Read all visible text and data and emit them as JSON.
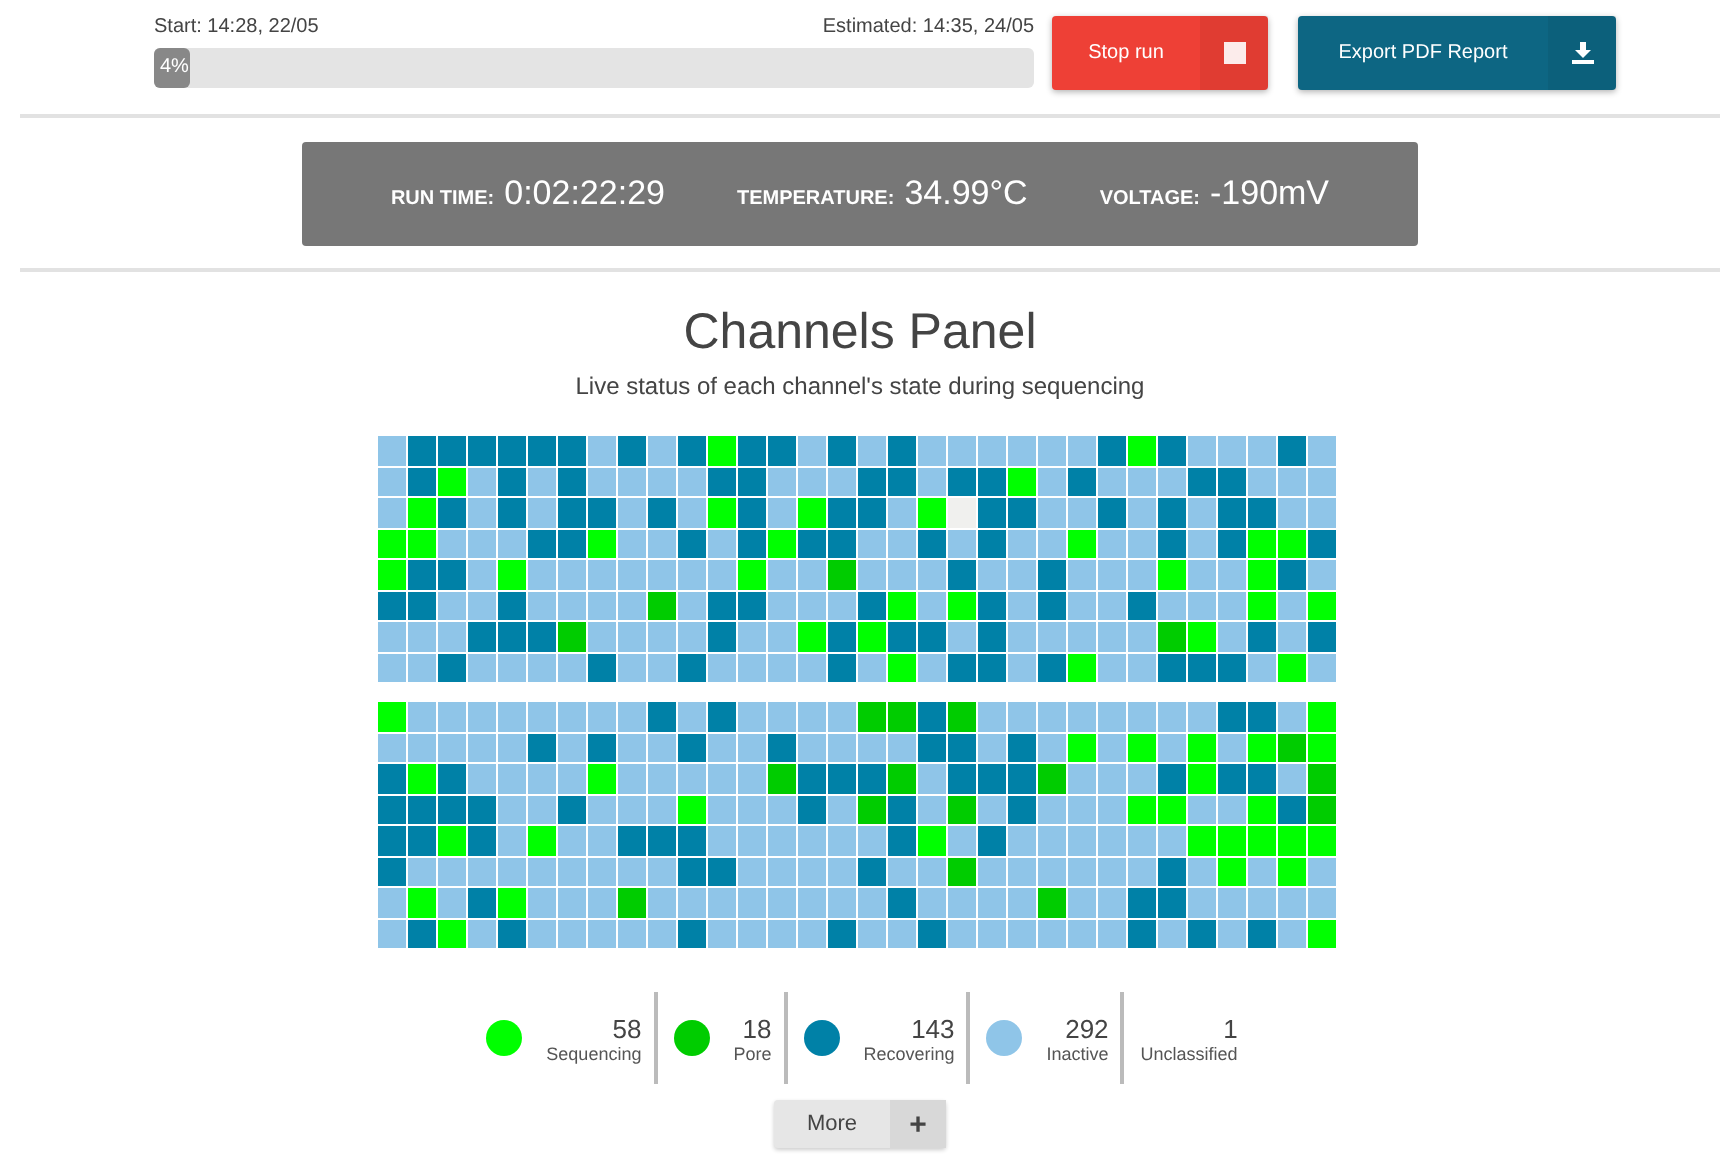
{
  "run_progress": {
    "start": "Start: 14:28, 22/05",
    "estimated": "Estimated: 14:35, 24/05",
    "level": 0.04,
    "label": "4%"
  },
  "buttons": [
    {
      "kind": "stop",
      "label": "Stop run"
    },
    {
      "kind": "export",
      "label": "Export PDF Report"
    }
  ],
  "stats": [
    {
      "label": "RUN TIME:",
      "value": "0:02:22:29"
    },
    {
      "label": "TEMPERATURE:",
      "value": "34.99°C"
    },
    {
      "label": "VOLTAGE:",
      "value": "-190mV"
    }
  ],
  "panel": {
    "title": "Channels Panel",
    "subtitle": "Live status of each channel's state during sequencing"
  },
  "channel_grid": {
    "blocks": [
      {
        "rows": [
          {
            "cells": [
              {
                "color": "#8fc5e8"
              },
              {
                "color": "#0081a7"
              },
              {
                "color": "#0081a7"
              },
              {
                "color": "#0081a7"
              },
              {
                "color": "#0081a7"
              },
              {
                "color": "#0081a7"
              },
              {
                "color": "#0081a7"
              },
              {
                "color": "#8fc5e8"
              },
              {
                "color": "#0081a7"
              },
              {
                "color": "#8fc5e8"
              },
              {
                "color": "#0081a7"
              },
              {
                "color": "#00ff00"
              },
              {
                "color": "#0081a7"
              },
              {
                "color": "#0081a7"
              },
              {
                "color": "#8fc5e8"
              },
              {
                "color": "#0081a7"
              },
              {
                "color": "#8fc5e8"
              },
              {
                "color": "#0081a7"
              },
              {
                "color": "#8fc5e8"
              },
              {
                "color": "#8fc5e8"
              },
              {
                "color": "#8fc5e8"
              },
              {
                "color": "#8fc5e8"
              },
              {
                "color": "#8fc5e8"
              },
              {
                "color": "#8fc5e8"
              },
              {
                "color": "#0081a7"
              },
              {
                "color": "#00ff00"
              },
              {
                "color": "#0081a7"
              },
              {
                "color": "#8fc5e8"
              },
              {
                "color": "#8fc5e8"
              },
              {
                "color": "#8fc5e8"
              },
              {
                "color": "#0081a7"
              },
              {
                "color": "#8fc5e8"
              }
            ]
          },
          {
            "cells": [
              {
                "color": "#8fc5e8"
              },
              {
                "color": "#0081a7"
              },
              {
                "color": "#00ff00"
              },
              {
                "color": "#8fc5e8"
              },
              {
                "color": "#0081a7"
              },
              {
                "color": "#8fc5e8"
              },
              {
                "color": "#0081a7"
              },
              {
                "color": "#8fc5e8"
              },
              {
                "color": "#8fc5e8"
              },
              {
                "color": "#8fc5e8"
              },
              {
                "color": "#8fc5e8"
              },
              {
                "color": "#0081a7"
              },
              {
                "color": "#0081a7"
              },
              {
                "color": "#8fc5e8"
              },
              {
                "color": "#8fc5e8"
              },
              {
                "color": "#8fc5e8"
              },
              {
                "color": "#0081a7"
              },
              {
                "color": "#0081a7"
              },
              {
                "color": "#8fc5e8"
              },
              {
                "color": "#0081a7"
              },
              {
                "color": "#0081a7"
              },
              {
                "color": "#00ff00"
              },
              {
                "color": "#8fc5e8"
              },
              {
                "color": "#0081a7"
              },
              {
                "color": "#8fc5e8"
              },
              {
                "color": "#8fc5e8"
              },
              {
                "color": "#8fc5e8"
              },
              {
                "color": "#0081a7"
              },
              {
                "color": "#0081a7"
              },
              {
                "color": "#8fc5e8"
              },
              {
                "color": "#8fc5e8"
              },
              {
                "color": "#8fc5e8"
              }
            ]
          },
          {
            "cells": [
              {
                "color": "#8fc5e8"
              },
              {
                "color": "#00ff00"
              },
              {
                "color": "#0081a7"
              },
              {
                "color": "#8fc5e8"
              },
              {
                "color": "#0081a7"
              },
              {
                "color": "#8fc5e8"
              },
              {
                "color": "#0081a7"
              },
              {
                "color": "#0081a7"
              },
              {
                "color": "#8fc5e8"
              },
              {
                "color": "#0081a7"
              },
              {
                "color": "#8fc5e8"
              },
              {
                "color": "#00ff00"
              },
              {
                "color": "#0081a7"
              },
              {
                "color": "#8fc5e8"
              },
              {
                "color": "#00ff00"
              },
              {
                "color": "#0081a7"
              },
              {
                "color": "#0081a7"
              },
              {
                "color": "#8fc5e8"
              },
              {
                "color": "#00ff00"
              },
              {
                "color": "#f0f0ee"
              },
              {
                "color": "#0081a7"
              },
              {
                "color": "#0081a7"
              },
              {
                "color": "#8fc5e8"
              },
              {
                "color": "#8fc5e8"
              },
              {
                "color": "#0081a7"
              },
              {
                "color": "#8fc5e8"
              },
              {
                "color": "#0081a7"
              },
              {
                "color": "#8fc5e8"
              },
              {
                "color": "#0081a7"
              },
              {
                "color": "#0081a7"
              },
              {
                "color": "#8fc5e8"
              },
              {
                "color": "#8fc5e8"
              }
            ]
          },
          {
            "cells": [
              {
                "color": "#00ff00"
              },
              {
                "color": "#00ff00"
              },
              {
                "color": "#8fc5e8"
              },
              {
                "color": "#8fc5e8"
              },
              {
                "color": "#8fc5e8"
              },
              {
                "color": "#0081a7"
              },
              {
                "color": "#0081a7"
              },
              {
                "color": "#00ff00"
              },
              {
                "color": "#8fc5e8"
              },
              {
                "color": "#8fc5e8"
              },
              {
                "color": "#0081a7"
              },
              {
                "color": "#8fc5e8"
              },
              {
                "color": "#0081a7"
              },
              {
                "color": "#00ff00"
              },
              {
                "color": "#0081a7"
              },
              {
                "color": "#0081a7"
              },
              {
                "color": "#8fc5e8"
              },
              {
                "color": "#8fc5e8"
              },
              {
                "color": "#0081a7"
              },
              {
                "color": "#8fc5e8"
              },
              {
                "color": "#0081a7"
              },
              {
                "color": "#8fc5e8"
              },
              {
                "color": "#8fc5e8"
              },
              {
                "color": "#00ff00"
              },
              {
                "color": "#8fc5e8"
              },
              {
                "color": "#8fc5e8"
              },
              {
                "color": "#0081a7"
              },
              {
                "color": "#8fc5e8"
              },
              {
                "color": "#0081a7"
              },
              {
                "color": "#00ff00"
              },
              {
                "color": "#00ff00"
              },
              {
                "color": "#0081a7"
              }
            ]
          },
          {
            "cells": [
              {
                "color": "#00ff00"
              },
              {
                "color": "#0081a7"
              },
              {
                "color": "#0081a7"
              },
              {
                "color": "#8fc5e8"
              },
              {
                "color": "#00ff00"
              },
              {
                "color": "#8fc5e8"
              },
              {
                "color": "#8fc5e8"
              },
              {
                "color": "#8fc5e8"
              },
              {
                "color": "#8fc5e8"
              },
              {
                "color": "#8fc5e8"
              },
              {
                "color": "#8fc5e8"
              },
              {
                "color": "#8fc5e8"
              },
              {
                "color": "#00ff00"
              },
              {
                "color": "#8fc5e8"
              },
              {
                "color": "#8fc5e8"
              },
              {
                "color": "#00cc00"
              },
              {
                "color": "#8fc5e8"
              },
              {
                "color": "#8fc5e8"
              },
              {
                "color": "#8fc5e8"
              },
              {
                "color": "#0081a7"
              },
              {
                "color": "#8fc5e8"
              },
              {
                "color": "#8fc5e8"
              },
              {
                "color": "#0081a7"
              },
              {
                "color": "#8fc5e8"
              },
              {
                "color": "#8fc5e8"
              },
              {
                "color": "#8fc5e8"
              },
              {
                "color": "#00ff00"
              },
              {
                "color": "#8fc5e8"
              },
              {
                "color": "#8fc5e8"
              },
              {
                "color": "#00ff00"
              },
              {
                "color": "#0081a7"
              },
              {
                "color": "#8fc5e8"
              }
            ]
          },
          {
            "cells": [
              {
                "color": "#0081a7"
              },
              {
                "color": "#0081a7"
              },
              {
                "color": "#8fc5e8"
              },
              {
                "color": "#8fc5e8"
              },
              {
                "color": "#0081a7"
              },
              {
                "color": "#8fc5e8"
              },
              {
                "color": "#8fc5e8"
              },
              {
                "color": "#8fc5e8"
              },
              {
                "color": "#8fc5e8"
              },
              {
                "color": "#00cc00"
              },
              {
                "color": "#8fc5e8"
              },
              {
                "color": "#0081a7"
              },
              {
                "color": "#0081a7"
              },
              {
                "color": "#8fc5e8"
              },
              {
                "color": "#8fc5e8"
              },
              {
                "color": "#8fc5e8"
              },
              {
                "color": "#0081a7"
              },
              {
                "color": "#00ff00"
              },
              {
                "color": "#8fc5e8"
              },
              {
                "color": "#00ff00"
              },
              {
                "color": "#0081a7"
              },
              {
                "color": "#8fc5e8"
              },
              {
                "color": "#0081a7"
              },
              {
                "color": "#8fc5e8"
              },
              {
                "color": "#8fc5e8"
              },
              {
                "color": "#0081a7"
              },
              {
                "color": "#8fc5e8"
              },
              {
                "color": "#8fc5e8"
              },
              {
                "color": "#8fc5e8"
              },
              {
                "color": "#00ff00"
              },
              {
                "color": "#8fc5e8"
              },
              {
                "color": "#00ff00"
              }
            ]
          },
          {
            "cells": [
              {
                "color": "#8fc5e8"
              },
              {
                "color": "#8fc5e8"
              },
              {
                "color": "#8fc5e8"
              },
              {
                "color": "#0081a7"
              },
              {
                "color": "#0081a7"
              },
              {
                "color": "#0081a7"
              },
              {
                "color": "#00cc00"
              },
              {
                "color": "#8fc5e8"
              },
              {
                "color": "#8fc5e8"
              },
              {
                "color": "#8fc5e8"
              },
              {
                "color": "#8fc5e8"
              },
              {
                "color": "#0081a7"
              },
              {
                "color": "#8fc5e8"
              },
              {
                "color": "#8fc5e8"
              },
              {
                "color": "#00ff00"
              },
              {
                "color": "#0081a7"
              },
              {
                "color": "#00ff00"
              },
              {
                "color": "#0081a7"
              },
              {
                "color": "#0081a7"
              },
              {
                "color": "#8fc5e8"
              },
              {
                "color": "#0081a7"
              },
              {
                "color": "#8fc5e8"
              },
              {
                "color": "#8fc5e8"
              },
              {
                "color": "#8fc5e8"
              },
              {
                "color": "#8fc5e8"
              },
              {
                "color": "#8fc5e8"
              },
              {
                "color": "#00cc00"
              },
              {
                "color": "#00ff00"
              },
              {
                "color": "#8fc5e8"
              },
              {
                "color": "#0081a7"
              },
              {
                "color": "#8fc5e8"
              },
              {
                "color": "#0081a7"
              }
            ]
          },
          {
            "cells": [
              {
                "color": "#8fc5e8"
              },
              {
                "color": "#8fc5e8"
              },
              {
                "color": "#0081a7"
              },
              {
                "color": "#8fc5e8"
              },
              {
                "color": "#8fc5e8"
              },
              {
                "color": "#8fc5e8"
              },
              {
                "color": "#8fc5e8"
              },
              {
                "color": "#0081a7"
              },
              {
                "color": "#8fc5e8"
              },
              {
                "color": "#8fc5e8"
              },
              {
                "color": "#0081a7"
              },
              {
                "color": "#8fc5e8"
              },
              {
                "color": "#8fc5e8"
              },
              {
                "color": "#8fc5e8"
              },
              {
                "color": "#8fc5e8"
              },
              {
                "color": "#0081a7"
              },
              {
                "color": "#8fc5e8"
              },
              {
                "color": "#00ff00"
              },
              {
                "color": "#8fc5e8"
              },
              {
                "color": "#0081a7"
              },
              {
                "color": "#0081a7"
              },
              {
                "color": "#8fc5e8"
              },
              {
                "color": "#0081a7"
              },
              {
                "color": "#00ff00"
              },
              {
                "color": "#8fc5e8"
              },
              {
                "color": "#8fc5e8"
              },
              {
                "color": "#0081a7"
              },
              {
                "color": "#0081a7"
              },
              {
                "color": "#0081a7"
              },
              {
                "color": "#8fc5e8"
              },
              {
                "color": "#00ff00"
              },
              {
                "color": "#8fc5e8"
              }
            ]
          }
        ]
      },
      {
        "rows": [
          {
            "cells": [
              {
                "color": "#00ff00"
              },
              {
                "color": "#8fc5e8"
              },
              {
                "color": "#8fc5e8"
              },
              {
                "color": "#8fc5e8"
              },
              {
                "color": "#8fc5e8"
              },
              {
                "color": "#8fc5e8"
              },
              {
                "color": "#8fc5e8"
              },
              {
                "color": "#8fc5e8"
              },
              {
                "color": "#8fc5e8"
              },
              {
                "color": "#0081a7"
              },
              {
                "color": "#8fc5e8"
              },
              {
                "color": "#0081a7"
              },
              {
                "color": "#8fc5e8"
              },
              {
                "color": "#8fc5e8"
              },
              {
                "color": "#8fc5e8"
              },
              {
                "color": "#8fc5e8"
              },
              {
                "color": "#00cc00"
              },
              {
                "color": "#00cc00"
              },
              {
                "color": "#0081a7"
              },
              {
                "color": "#00cc00"
              },
              {
                "color": "#8fc5e8"
              },
              {
                "color": "#8fc5e8"
              },
              {
                "color": "#8fc5e8"
              },
              {
                "color": "#8fc5e8"
              },
              {
                "color": "#8fc5e8"
              },
              {
                "color": "#8fc5e8"
              },
              {
                "color": "#8fc5e8"
              },
              {
                "color": "#8fc5e8"
              },
              {
                "color": "#0081a7"
              },
              {
                "color": "#0081a7"
              },
              {
                "color": "#8fc5e8"
              },
              {
                "color": "#00ff00"
              }
            ]
          },
          {
            "cells": [
              {
                "color": "#8fc5e8"
              },
              {
                "color": "#8fc5e8"
              },
              {
                "color": "#8fc5e8"
              },
              {
                "color": "#8fc5e8"
              },
              {
                "color": "#8fc5e8"
              },
              {
                "color": "#0081a7"
              },
              {
                "color": "#8fc5e8"
              },
              {
                "color": "#0081a7"
              },
              {
                "color": "#8fc5e8"
              },
              {
                "color": "#8fc5e8"
              },
              {
                "color": "#0081a7"
              },
              {
                "color": "#8fc5e8"
              },
              {
                "color": "#8fc5e8"
              },
              {
                "color": "#0081a7"
              },
              {
                "color": "#8fc5e8"
              },
              {
                "color": "#8fc5e8"
              },
              {
                "color": "#8fc5e8"
              },
              {
                "color": "#8fc5e8"
              },
              {
                "color": "#0081a7"
              },
              {
                "color": "#0081a7"
              },
              {
                "color": "#8fc5e8"
              },
              {
                "color": "#0081a7"
              },
              {
                "color": "#8fc5e8"
              },
              {
                "color": "#00ff00"
              },
              {
                "color": "#8fc5e8"
              },
              {
                "color": "#00ff00"
              },
              {
                "color": "#8fc5e8"
              },
              {
                "color": "#00ff00"
              },
              {
                "color": "#8fc5e8"
              },
              {
                "color": "#00ff00"
              },
              {
                "color": "#00cc00"
              },
              {
                "color": "#00ff00"
              }
            ]
          },
          {
            "cells": [
              {
                "color": "#0081a7"
              },
              {
                "color": "#00ff00"
              },
              {
                "color": "#0081a7"
              },
              {
                "color": "#8fc5e8"
              },
              {
                "color": "#8fc5e8"
              },
              {
                "color": "#8fc5e8"
              },
              {
                "color": "#8fc5e8"
              },
              {
                "color": "#00ff00"
              },
              {
                "color": "#8fc5e8"
              },
              {
                "color": "#8fc5e8"
              },
              {
                "color": "#8fc5e8"
              },
              {
                "color": "#8fc5e8"
              },
              {
                "color": "#8fc5e8"
              },
              {
                "color": "#00cc00"
              },
              {
                "color": "#0081a7"
              },
              {
                "color": "#0081a7"
              },
              {
                "color": "#0081a7"
              },
              {
                "color": "#00cc00"
              },
              {
                "color": "#8fc5e8"
              },
              {
                "color": "#0081a7"
              },
              {
                "color": "#0081a7"
              },
              {
                "color": "#0081a7"
              },
              {
                "color": "#00cc00"
              },
              {
                "color": "#8fc5e8"
              },
              {
                "color": "#8fc5e8"
              },
              {
                "color": "#8fc5e8"
              },
              {
                "color": "#0081a7"
              },
              {
                "color": "#00ff00"
              },
              {
                "color": "#0081a7"
              },
              {
                "color": "#0081a7"
              },
              {
                "color": "#8fc5e8"
              },
              {
                "color": "#00cc00"
              }
            ]
          },
          {
            "cells": [
              {
                "color": "#0081a7"
              },
              {
                "color": "#0081a7"
              },
              {
                "color": "#0081a7"
              },
              {
                "color": "#0081a7"
              },
              {
                "color": "#8fc5e8"
              },
              {
                "color": "#8fc5e8"
              },
              {
                "color": "#0081a7"
              },
              {
                "color": "#8fc5e8"
              },
              {
                "color": "#8fc5e8"
              },
              {
                "color": "#8fc5e8"
              },
              {
                "color": "#00ff00"
              },
              {
                "color": "#8fc5e8"
              },
              {
                "color": "#8fc5e8"
              },
              {
                "color": "#8fc5e8"
              },
              {
                "color": "#0081a7"
              },
              {
                "color": "#8fc5e8"
              },
              {
                "color": "#00cc00"
              },
              {
                "color": "#0081a7"
              },
              {
                "color": "#8fc5e8"
              },
              {
                "color": "#00cc00"
              },
              {
                "color": "#8fc5e8"
              },
              {
                "color": "#0081a7"
              },
              {
                "color": "#8fc5e8"
              },
              {
                "color": "#8fc5e8"
              },
              {
                "color": "#8fc5e8"
              },
              {
                "color": "#00ff00"
              },
              {
                "color": "#00ff00"
              },
              {
                "color": "#8fc5e8"
              },
              {
                "color": "#8fc5e8"
              },
              {
                "color": "#00ff00"
              },
              {
                "color": "#0081a7"
              },
              {
                "color": "#00cc00"
              }
            ]
          },
          {
            "cells": [
              {
                "color": "#0081a7"
              },
              {
                "color": "#0081a7"
              },
              {
                "color": "#00ff00"
              },
              {
                "color": "#0081a7"
              },
              {
                "color": "#8fc5e8"
              },
              {
                "color": "#00ff00"
              },
              {
                "color": "#8fc5e8"
              },
              {
                "color": "#8fc5e8"
              },
              {
                "color": "#0081a7"
              },
              {
                "color": "#0081a7"
              },
              {
                "color": "#0081a7"
              },
              {
                "color": "#8fc5e8"
              },
              {
                "color": "#8fc5e8"
              },
              {
                "color": "#8fc5e8"
              },
              {
                "color": "#8fc5e8"
              },
              {
                "color": "#8fc5e8"
              },
              {
                "color": "#8fc5e8"
              },
              {
                "color": "#0081a7"
              },
              {
                "color": "#00ff00"
              },
              {
                "color": "#8fc5e8"
              },
              {
                "color": "#0081a7"
              },
              {
                "color": "#8fc5e8"
              },
              {
                "color": "#8fc5e8"
              },
              {
                "color": "#8fc5e8"
              },
              {
                "color": "#8fc5e8"
              },
              {
                "color": "#8fc5e8"
              },
              {
                "color": "#8fc5e8"
              },
              {
                "color": "#00ff00"
              },
              {
                "color": "#00ff00"
              },
              {
                "color": "#00ff00"
              },
              {
                "color": "#00ff00"
              },
              {
                "color": "#00ff00"
              }
            ]
          },
          {
            "cells": [
              {
                "color": "#0081a7"
              },
              {
                "color": "#8fc5e8"
              },
              {
                "color": "#8fc5e8"
              },
              {
                "color": "#8fc5e8"
              },
              {
                "color": "#8fc5e8"
              },
              {
                "color": "#8fc5e8"
              },
              {
                "color": "#8fc5e8"
              },
              {
                "color": "#8fc5e8"
              },
              {
                "color": "#8fc5e8"
              },
              {
                "color": "#8fc5e8"
              },
              {
                "color": "#0081a7"
              },
              {
                "color": "#0081a7"
              },
              {
                "color": "#8fc5e8"
              },
              {
                "color": "#8fc5e8"
              },
              {
                "color": "#8fc5e8"
              },
              {
                "color": "#8fc5e8"
              },
              {
                "color": "#0081a7"
              },
              {
                "color": "#8fc5e8"
              },
              {
                "color": "#8fc5e8"
              },
              {
                "color": "#00cc00"
              },
              {
                "color": "#8fc5e8"
              },
              {
                "color": "#8fc5e8"
              },
              {
                "color": "#8fc5e8"
              },
              {
                "color": "#8fc5e8"
              },
              {
                "color": "#8fc5e8"
              },
              {
                "color": "#8fc5e8"
              },
              {
                "color": "#0081a7"
              },
              {
                "color": "#8fc5e8"
              },
              {
                "color": "#00ff00"
              },
              {
                "color": "#8fc5e8"
              },
              {
                "color": "#00ff00"
              },
              {
                "color": "#8fc5e8"
              }
            ]
          },
          {
            "cells": [
              {
                "color": "#8fc5e8"
              },
              {
                "color": "#00ff00"
              },
              {
                "color": "#8fc5e8"
              },
              {
                "color": "#0081a7"
              },
              {
                "color": "#00ff00"
              },
              {
                "color": "#8fc5e8"
              },
              {
                "color": "#8fc5e8"
              },
              {
                "color": "#8fc5e8"
              },
              {
                "color": "#00cc00"
              },
              {
                "color": "#8fc5e8"
              },
              {
                "color": "#8fc5e8"
              },
              {
                "color": "#8fc5e8"
              },
              {
                "color": "#8fc5e8"
              },
              {
                "color": "#8fc5e8"
              },
              {
                "color": "#8fc5e8"
              },
              {
                "color": "#8fc5e8"
              },
              {
                "color": "#8fc5e8"
              },
              {
                "color": "#0081a7"
              },
              {
                "color": "#8fc5e8"
              },
              {
                "color": "#8fc5e8"
              },
              {
                "color": "#8fc5e8"
              },
              {
                "color": "#8fc5e8"
              },
              {
                "color": "#00cc00"
              },
              {
                "color": "#8fc5e8"
              },
              {
                "color": "#8fc5e8"
              },
              {
                "color": "#0081a7"
              },
              {
                "color": "#0081a7"
              },
              {
                "color": "#8fc5e8"
              },
              {
                "color": "#8fc5e8"
              },
              {
                "color": "#8fc5e8"
              },
              {
                "color": "#8fc5e8"
              },
              {
                "color": "#8fc5e8"
              }
            ]
          },
          {
            "cells": [
              {
                "color": "#8fc5e8"
              },
              {
                "color": "#0081a7"
              },
              {
                "color": "#00ff00"
              },
              {
                "color": "#8fc5e8"
              },
              {
                "color": "#0081a7"
              },
              {
                "color": "#8fc5e8"
              },
              {
                "color": "#8fc5e8"
              },
              {
                "color": "#8fc5e8"
              },
              {
                "color": "#8fc5e8"
              },
              {
                "color": "#8fc5e8"
              },
              {
                "color": "#0081a7"
              },
              {
                "color": "#8fc5e8"
              },
              {
                "color": "#8fc5e8"
              },
              {
                "color": "#8fc5e8"
              },
              {
                "color": "#8fc5e8"
              },
              {
                "color": "#0081a7"
              },
              {
                "color": "#8fc5e8"
              },
              {
                "color": "#8fc5e8"
              },
              {
                "color": "#0081a7"
              },
              {
                "color": "#8fc5e8"
              },
              {
                "color": "#8fc5e8"
              },
              {
                "color": "#8fc5e8"
              },
              {
                "color": "#8fc5e8"
              },
              {
                "color": "#8fc5e8"
              },
              {
                "color": "#8fc5e8"
              },
              {
                "color": "#0081a7"
              },
              {
                "color": "#8fc5e8"
              },
              {
                "color": "#0081a7"
              },
              {
                "color": "#8fc5e8"
              },
              {
                "color": "#0081a7"
              },
              {
                "color": "#8fc5e8"
              },
              {
                "color": "#00ff00"
              }
            ]
          }
        ]
      }
    ]
  },
  "legend": [
    {
      "count": "58",
      "label": "Sequencing",
      "color": "#00ff00"
    },
    {
      "count": "18",
      "label": "Pore",
      "color": "#00cc00"
    },
    {
      "count": "143",
      "label": "Recovering",
      "color": "#0081a7"
    },
    {
      "count": "292",
      "label": "Inactive",
      "color": "#8fc5e8"
    },
    {
      "count": "1",
      "label": "Unclassified"
    }
  ],
  "more_button": {
    "label": "More",
    "icon": "+"
  }
}
